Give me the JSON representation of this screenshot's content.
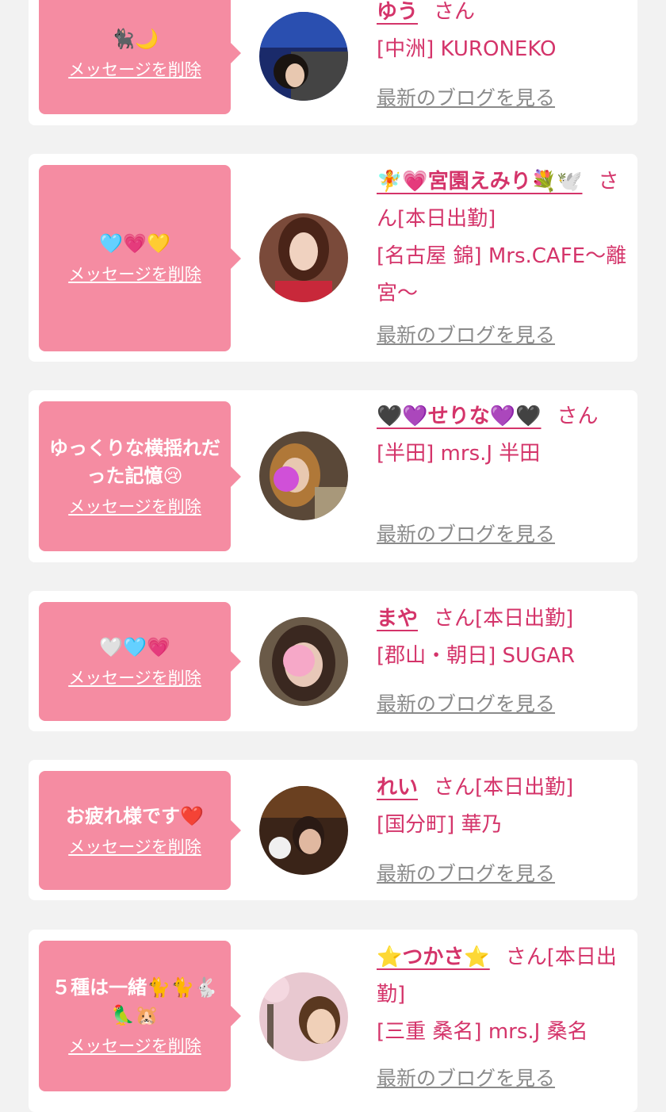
{
  "delete_label": "メッセージを削除",
  "blog_label": "最新のブログを見る",
  "san_label": "さん",
  "cards": [
    {
      "message": "🐈‍⬛🌙",
      "name": "ゆう",
      "status": "",
      "shop": "[中洲] KURONEKO"
    },
    {
      "message": "🩵💗💛",
      "name": "🧚💗宮園えみり💐🕊️",
      "status": "[本日出勤]",
      "shop": "[名古屋 錦] Mrs.CAFE〜離宮〜"
    },
    {
      "message": "ゆっくりな横揺れだった記憶😢",
      "name": "🖤💜せりな💜🖤",
      "status": "",
      "shop": "[半田] mrs.J 半田"
    },
    {
      "message": "🤍🩵💗",
      "name": "まや",
      "status": "[本日出勤]",
      "shop": "[郡山・朝日] SUGAR"
    },
    {
      "message": "お疲れ様です❤️",
      "name": "れい",
      "status": "[本日出勤]",
      "shop": "[国分町] 華乃"
    },
    {
      "message": "５種は一緒🐈🐈🐇🦜🐹",
      "name": "⭐️つかさ⭐️",
      "status": "[本日出勤]",
      "shop": "[三重 桑名] mrs.J 桑名"
    }
  ],
  "colors": {
    "page_bg": "#f2f2f2",
    "card_bg": "#ffffff",
    "bubble_bg": "#f58ca2",
    "accent_text": "#d4346a",
    "link_gray": "#8a8a8a"
  }
}
